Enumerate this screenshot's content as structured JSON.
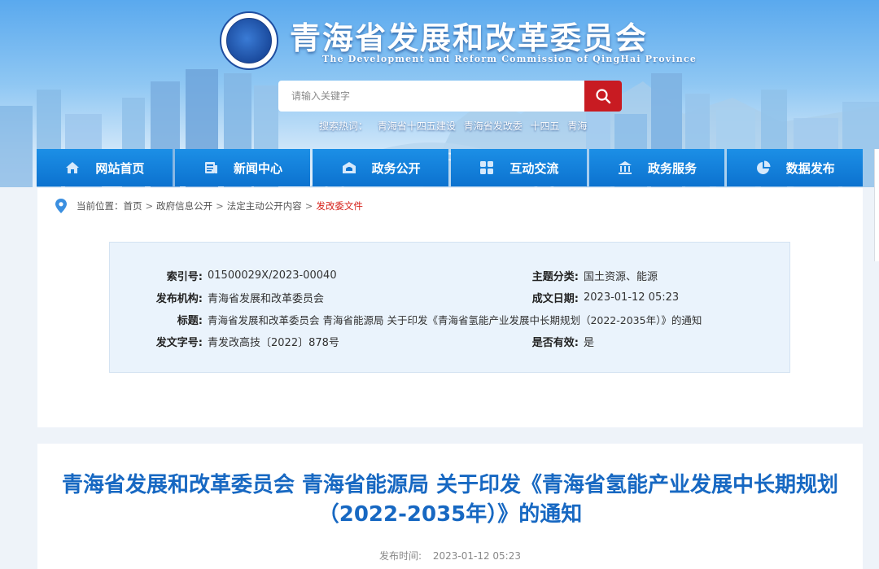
{
  "header": {
    "site_title": "青海省发展和改革委员会",
    "site_subtitle": "The Development and Reform Commission of QingHai Province",
    "search_placeholder": "请输入关键字",
    "hot_label": "搜索热词：",
    "hot_words": [
      "青海省十四五建设",
      "青海省发改委",
      "十四五",
      "青海"
    ]
  },
  "nav": {
    "items": [
      {
        "label": "网站首页",
        "icon": "home-icon"
      },
      {
        "label": "新闻中心",
        "icon": "news-icon"
      },
      {
        "label": "政务公开",
        "icon": "open-gov-icon"
      },
      {
        "label": "互动交流",
        "icon": "interaction-icon"
      },
      {
        "label": "政务服务",
        "icon": "service-building-icon"
      },
      {
        "label": "数据发布",
        "icon": "pie-chart-icon"
      }
    ]
  },
  "breadcrumb": {
    "label": "当前位置：",
    "items": [
      "首页",
      "政府信息公开",
      "法定主动公开内容",
      "发改委文件"
    ],
    "separator": ">"
  },
  "meta": {
    "index_label": "索引号:",
    "index_value": "01500029X/2023-00040",
    "topic_label": "主题分类:",
    "topic_value": "国土资源、能源",
    "publisher_label": "发布机构:",
    "publisher_value": "青海省发展和改革委员会",
    "date_label": "成文日期:",
    "date_value": "2023-01-12 05:23",
    "title_label": "标题:",
    "title_value": "青海省发展和改革委员会 青海省能源局 关于印发《青海省氢能产业发展中长期规划（2022-2035年）》的通知",
    "docno_label": "发文字号:",
    "docno_value": "青发改高技〔2022〕878号",
    "valid_label": "是否有效:",
    "valid_value": "是"
  },
  "article": {
    "title": "青海省发展和改革委员会 青海省能源局 关于印发《青海省氢能产业发展中长期规划（2022-2035年）》的通知",
    "publish_label": "发布时间:",
    "publish_time": "2023-01-12 05:23"
  },
  "colors": {
    "nav_blue": "#0c72cf",
    "title_blue": "#1768c2",
    "search_red": "#c81b22",
    "crumb_current_red": "#d6221a"
  }
}
